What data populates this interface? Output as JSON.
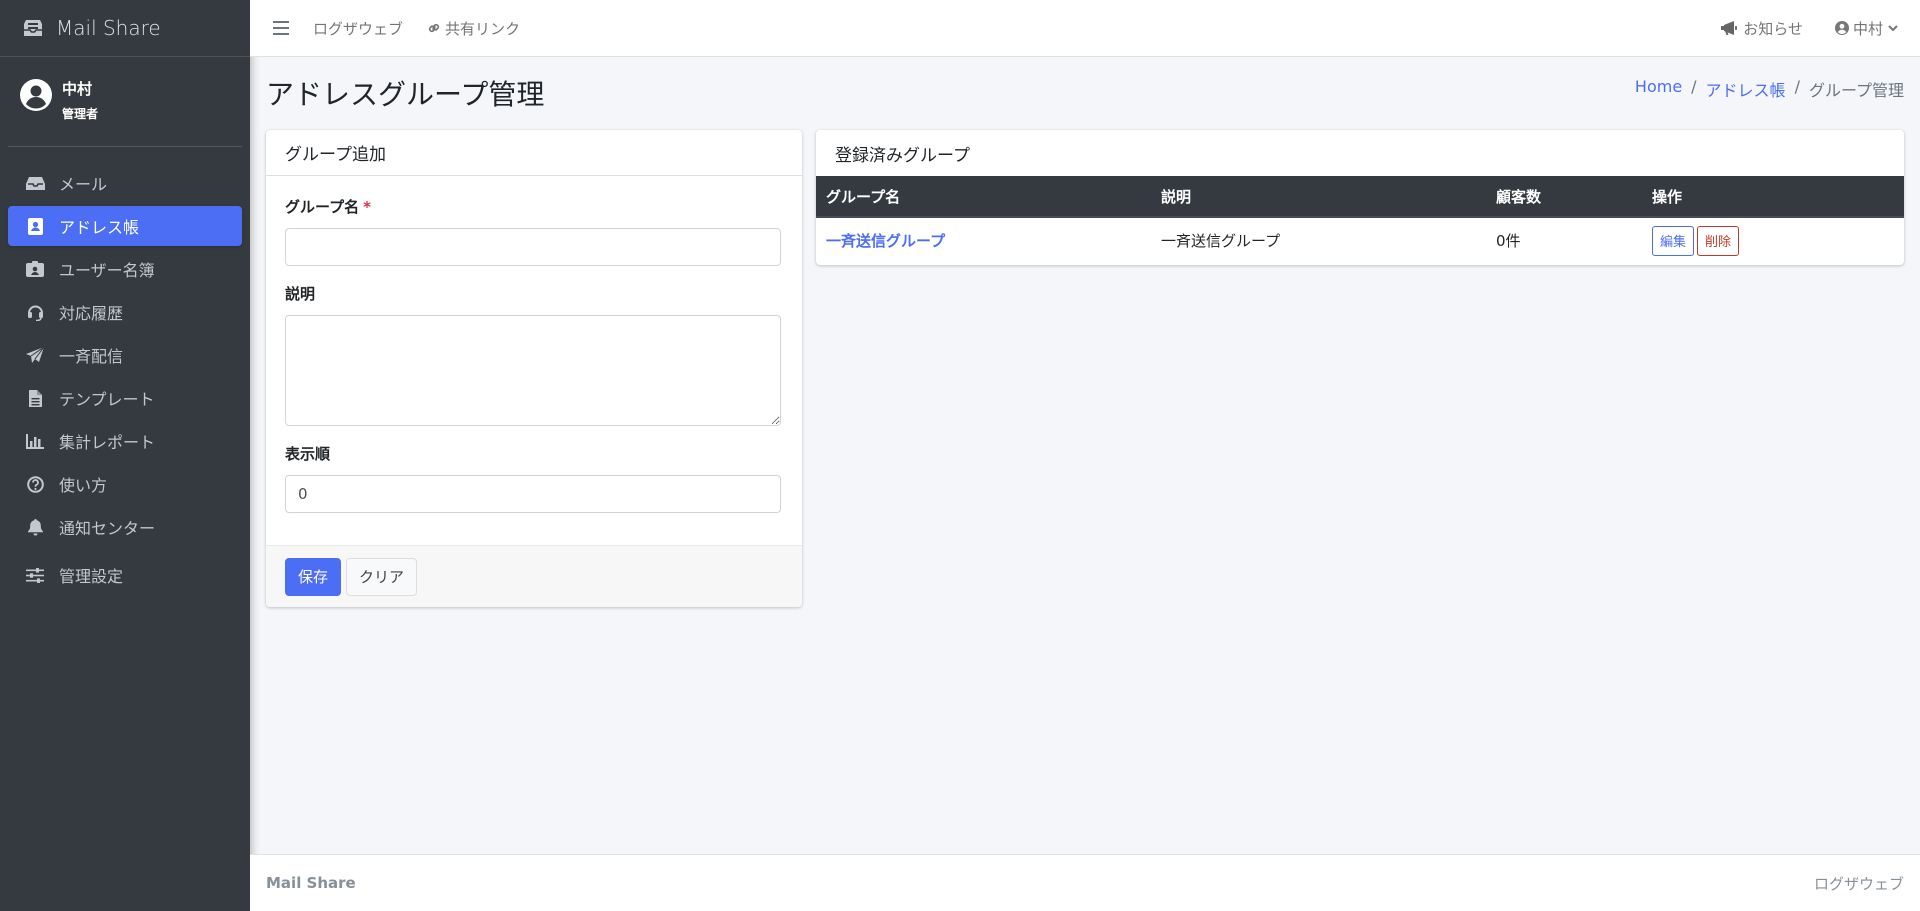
{
  "app": {
    "title": "Mail Share"
  },
  "user": {
    "name": "中村",
    "role": "管理者"
  },
  "sidebar": {
    "items": [
      {
        "label": "メール",
        "icon": "inbox-icon"
      },
      {
        "label": "アドレス帳",
        "icon": "address-book-icon",
        "active": true
      },
      {
        "label": "ユーザー名簿",
        "icon": "id-badge-icon"
      },
      {
        "label": "対応履歴",
        "icon": "headset-icon"
      },
      {
        "label": "一斉配信",
        "icon": "paper-plane-icon"
      },
      {
        "label": "テンプレート",
        "icon": "file-icon"
      },
      {
        "label": "集計レポート",
        "icon": "bar-chart-icon"
      },
      {
        "label": "使い方",
        "icon": "question-circle-icon"
      },
      {
        "label": "通知センター",
        "icon": "bell-icon"
      },
      {
        "label": "管理設定",
        "icon": "sliders-icon"
      }
    ]
  },
  "topbar": {
    "log_web": "ログザウェブ",
    "share_link": "共有リンク",
    "notice": "お知らせ",
    "user": "中村"
  },
  "page": {
    "title": "アドレスグループ管理",
    "breadcrumb": {
      "home": "Home",
      "address_book": "アドレス帳",
      "current": "グループ管理"
    }
  },
  "form": {
    "header": "グループ追加",
    "group_name_label": "グループ名",
    "required_mark": "*",
    "group_name_value": "",
    "description_label": "説明",
    "description_value": "",
    "order_label": "表示順",
    "order_value": "0",
    "save_label": "保存",
    "clear_label": "クリア"
  },
  "list": {
    "header": "登録済みグループ",
    "columns": [
      "グループ名",
      "説明",
      "顧客数",
      "操作"
    ],
    "rows": [
      {
        "name": "一斉送信グループ",
        "description": "一斉送信グループ",
        "count": "0件",
        "edit": "編集",
        "delete": "削除"
      }
    ]
  },
  "footer": {
    "left": "Mail Share",
    "right": "ログザウェブ"
  },
  "colors": {
    "accent": "#4c6ef5",
    "sidebar": "#343a40",
    "danger": "#c0392b"
  }
}
